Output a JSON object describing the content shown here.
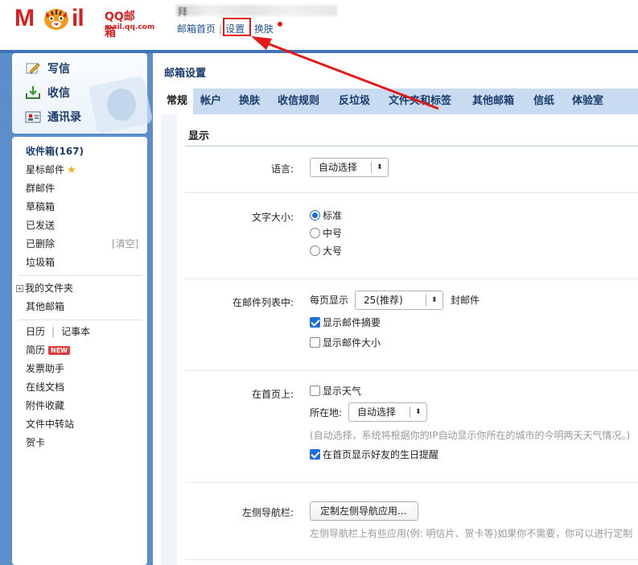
{
  "header": {
    "logo_letters": "Mil",
    "logo_m": "M",
    "logo_il": "il",
    "logo_text": "QQ邮箱",
    "logo_sub": "mail.qq.com",
    "user_char": "拜",
    "links": [
      "邮箱首页",
      "设置",
      "换肤"
    ],
    "separator": "|"
  },
  "sidebar": {
    "actions": [
      {
        "label": "写信",
        "icon": "pencil-icon"
      },
      {
        "label": "收信",
        "icon": "inbox-download-icon"
      },
      {
        "label": "通讯录",
        "icon": "contacts-card-icon"
      }
    ],
    "folders": [
      {
        "label": "收件箱(167)",
        "bold": true
      },
      {
        "label": "星标邮件",
        "star": true
      },
      {
        "label": "群邮件"
      },
      {
        "label": "草稿箱"
      },
      {
        "label": "已发送"
      },
      {
        "label": "已删除",
        "action": "[清空]"
      },
      {
        "label": "垃圾箱"
      }
    ],
    "my_folders": "我的文件夹",
    "plus": "+",
    "other_mail": "其他邮箱",
    "calendar": "日历",
    "notes": "记事本",
    "apps": [
      {
        "label": "简历",
        "badge": "NEW"
      },
      {
        "label": "发票助手"
      },
      {
        "label": "在线文档"
      },
      {
        "label": "附件收藏"
      },
      {
        "label": "文件中转站"
      },
      {
        "label": "贺卡"
      }
    ]
  },
  "main": {
    "title": "邮箱设置",
    "tabs": [
      "常规",
      "帐户",
      "换肤",
      "收信规则",
      "反垃圾",
      "文件夹和标签",
      "其他邮箱",
      "信纸",
      "体验室"
    ],
    "active_tab": "常规",
    "section_title": "显示",
    "language": {
      "label": "语言:",
      "value": "自动选择"
    },
    "font_size": {
      "label": "文字大小:",
      "options": [
        "标准",
        "中号",
        "大号"
      ],
      "selected": "标准"
    },
    "list": {
      "label": "在邮件列表中:",
      "per_page_prefix": "每页显示",
      "per_page_value": "25(推荐)",
      "per_page_suffix": "封邮件",
      "show_summary": "显示邮件摘要",
      "show_summary_checked": true,
      "show_size": "显示邮件大小",
      "show_size_checked": false
    },
    "home": {
      "label": "在首页上:",
      "weather": "显示天气",
      "weather_checked": false,
      "location_label": "所在地:",
      "location_value": "自动选择",
      "hint": "(自动选择，系统将根据你的IP自动显示你所在的城市的今明两天天气情况。)",
      "birthday": "在首页显示好友的生日提醒",
      "birthday_checked": true
    },
    "nav": {
      "label": "左侧导航栏:",
      "button": "定制左侧导航应用...",
      "hint": "左侧导航栏上有些应用(例: 明信片、贺卡等)如果你不需要，你可以进行定制"
    }
  },
  "colors": {
    "brand_red": "#d6201f",
    "link_blue": "#1e5494",
    "frame_blue": "#5b8ecb",
    "tab_bg": "#c8dbf0",
    "checked_blue": "#1e6fd9",
    "annotation_red": "#e31818"
  }
}
